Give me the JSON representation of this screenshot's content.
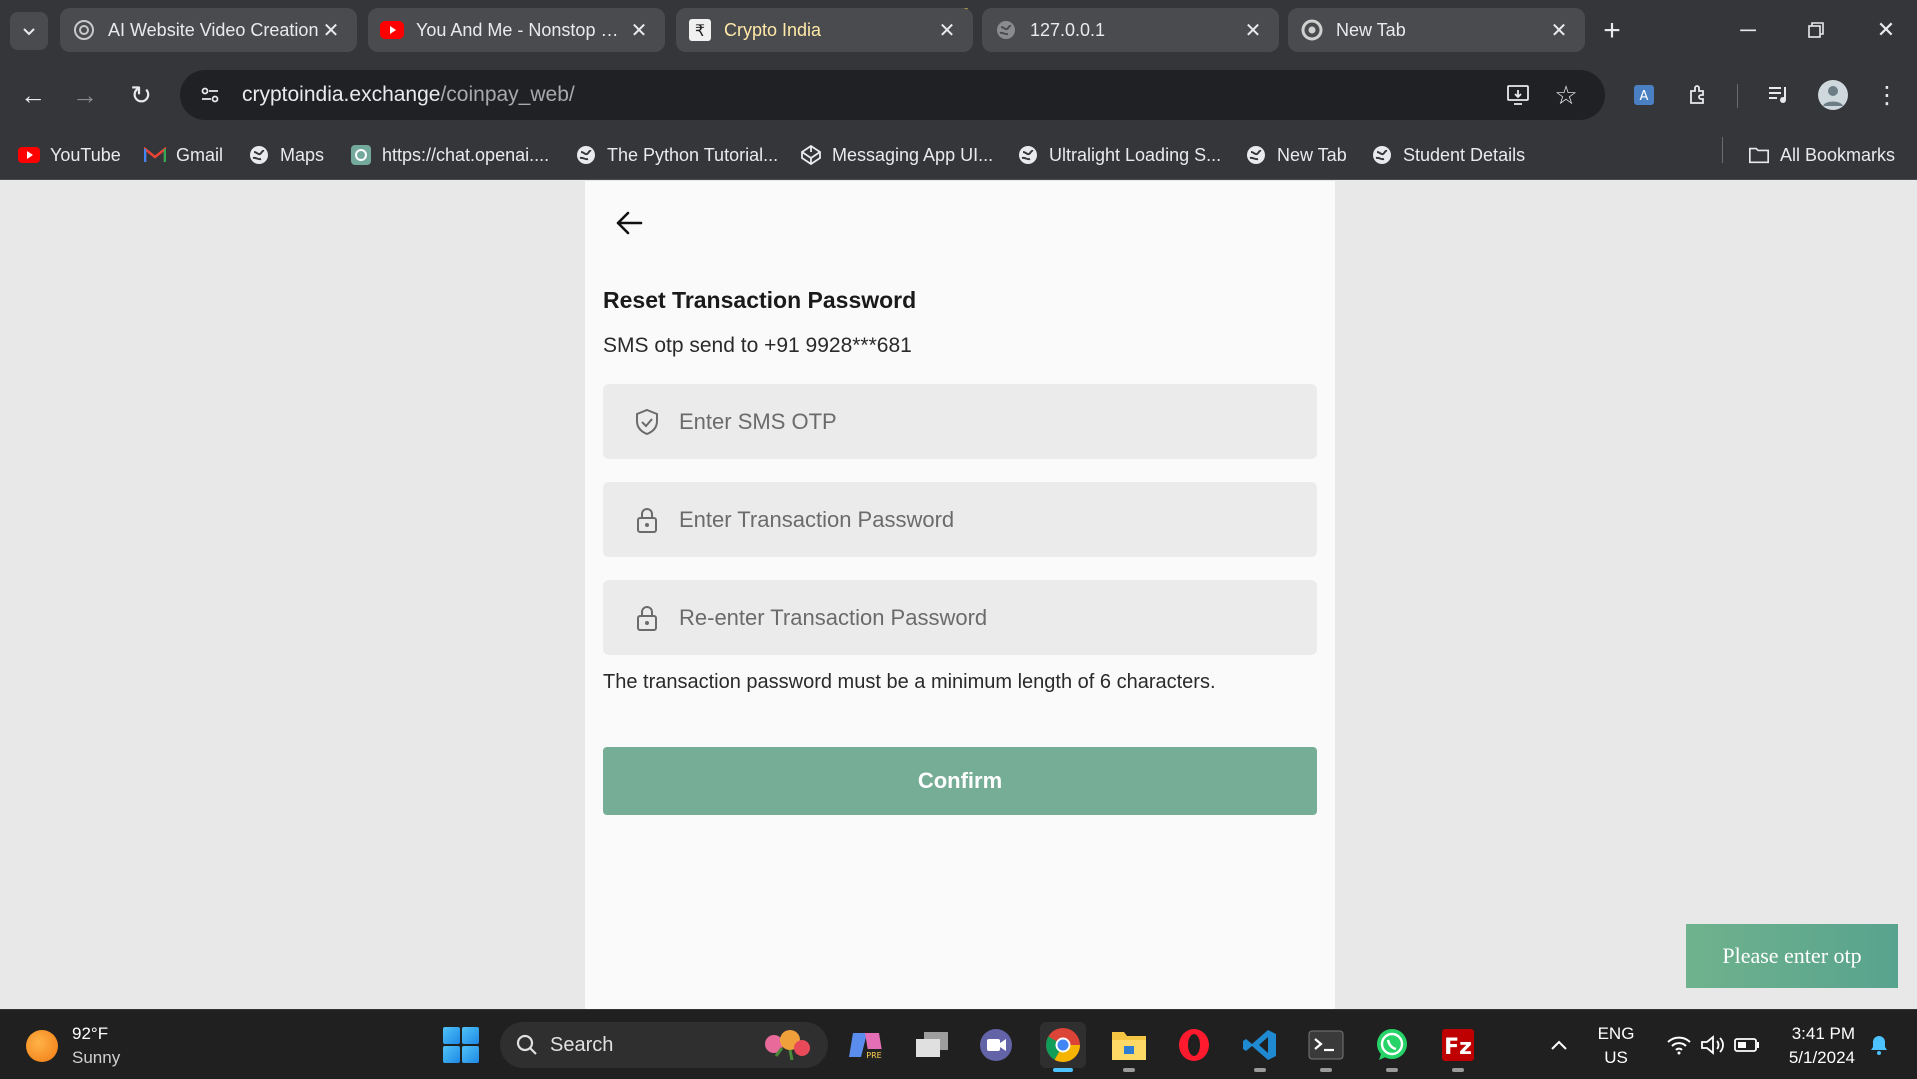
{
  "browser": {
    "tabs": [
      {
        "title": "AI Website Video Creation",
        "favicon": "chatgpt-icon"
      },
      {
        "title": "You And Me - Nonstop Party",
        "favicon": "youtube-icon"
      },
      {
        "title": "Crypto India",
        "favicon": "rupee-icon",
        "active": true
      },
      {
        "title": "127.0.0.1",
        "favicon": "globe-icon"
      },
      {
        "title": "New Tab",
        "favicon": "chrome-icon"
      }
    ],
    "url_domain": "cryptoindia.exchange",
    "url_path": "/coinpay_web/",
    "bookmarks": [
      {
        "label": "YouTube",
        "icon": "youtube-icon"
      },
      {
        "label": "Gmail",
        "icon": "gmail-icon"
      },
      {
        "label": "Maps",
        "icon": "globe-icon"
      },
      {
        "label": "https://chat.openai....",
        "icon": "chatgpt-icon"
      },
      {
        "label": "The Python Tutorial...",
        "icon": "globe-icon"
      },
      {
        "label": "Messaging App UI...",
        "icon": "codepen-icon"
      },
      {
        "label": "Ultralight Loading S...",
        "icon": "globe-icon"
      },
      {
        "label": "New Tab",
        "icon": "globe-icon"
      },
      {
        "label": "Student Details",
        "icon": "globe-icon"
      }
    ],
    "all_bookmarks": "All Bookmarks"
  },
  "form": {
    "title": "Reset Transaction Password",
    "subtitle": "SMS otp send to +91 9928***681",
    "otp_placeholder": "Enter SMS OTP",
    "password_placeholder": "Enter Transaction Password",
    "repassword_placeholder": "Re-enter Transaction Password",
    "hint": "The transaction password must be a minimum length of 6 characters.",
    "confirm_label": "Confirm"
  },
  "toast": {
    "message": "Please enter otp"
  },
  "taskbar": {
    "temperature": "92°F",
    "condition": "Sunny",
    "search_label": "Search",
    "lang_line1": "ENG",
    "lang_line2": "US",
    "time": "3:41 PM",
    "date": "5/1/2024"
  },
  "colors": {
    "confirm_button": "#75ad97",
    "toast": "#62ab8e",
    "chrome_frame": "#35363a"
  }
}
